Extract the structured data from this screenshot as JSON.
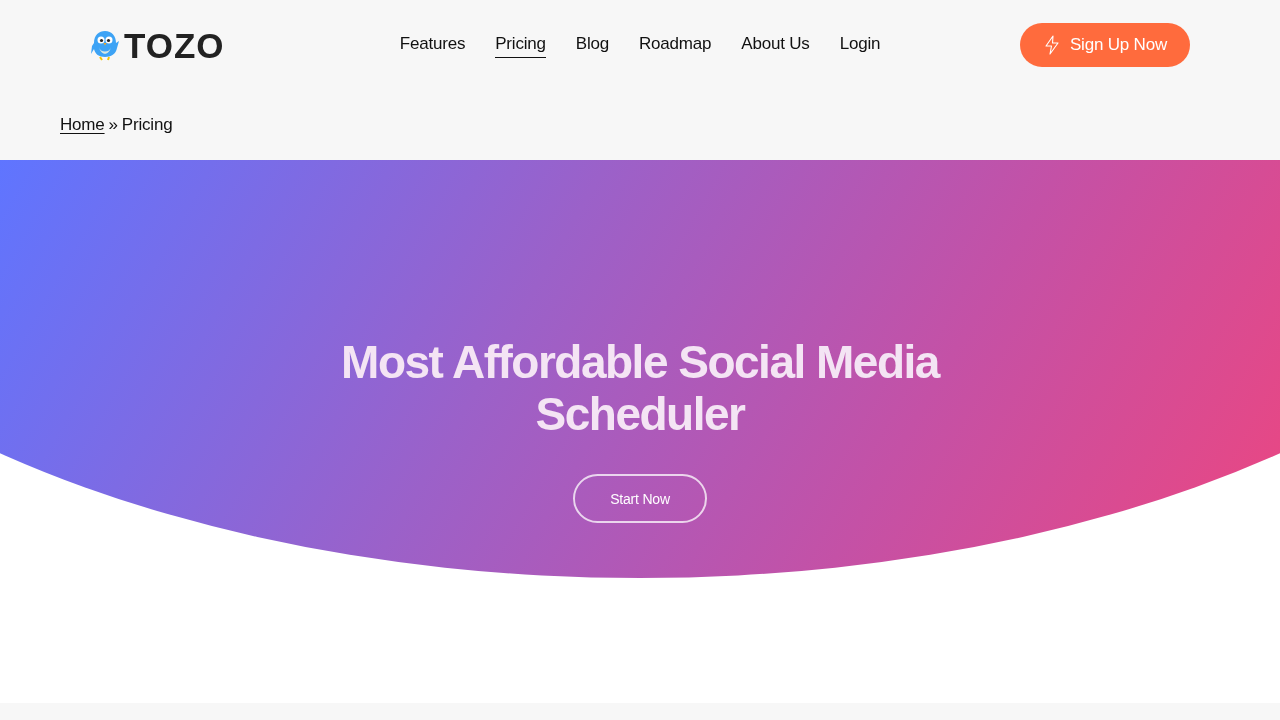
{
  "header": {
    "logo": {
      "text": "TOZO"
    },
    "nav": [
      {
        "label": "Features",
        "selected": false
      },
      {
        "label": "Pricing",
        "selected": true
      },
      {
        "label": "Blog",
        "selected": false
      },
      {
        "label": "Roadmap",
        "selected": false
      },
      {
        "label": "About Us",
        "selected": false
      },
      {
        "label": "Login",
        "selected": false
      }
    ],
    "cta": {
      "label": "Sign Up Now"
    }
  },
  "breadcrumb": {
    "items": [
      {
        "label": "Home",
        "kind": "link"
      },
      {
        "label": "Pricing",
        "kind": "current"
      }
    ],
    "separator": "»"
  },
  "hero": {
    "title": "Most Affordable Social Media Scheduler",
    "button": "Start Now"
  }
}
